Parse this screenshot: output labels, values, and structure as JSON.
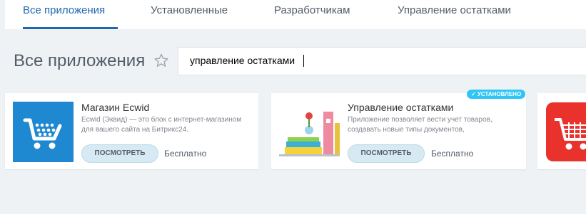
{
  "tabs": [
    {
      "label": "Все приложения",
      "active": true
    },
    {
      "label": "Установленные",
      "active": false
    },
    {
      "label": "Разработчикам",
      "active": false
    },
    {
      "label": "Управление остатками",
      "active": false
    }
  ],
  "page_title": "Все приложения",
  "search": {
    "value": "управление остатками"
  },
  "apps": [
    {
      "title": "Магазин Ecwid",
      "description": "Ecwid (Эквид) — это блок с интернет-магазином для вашего сайта на Битрикс24.",
      "button": "ПОСМОТРЕТЬ",
      "price": "Бесплатно",
      "icon": "shopping-cart-icon"
    },
    {
      "title": "Управление остатками",
      "description": "Приложение позволяет вести учет товаров, создавать новые типы документов,",
      "button": "ПОСМОТРЕТЬ",
      "price": "Бесплатно",
      "badge": "✓ УСТАНОВЛЕНО",
      "icon": "inventory-illustration-icon"
    },
    {
      "icon": "shopping-cart-icon"
    }
  ],
  "colors": {
    "accent": "#2067b0",
    "badge": "#2fc6f6",
    "ecwid_blue": "#1e88d0",
    "cart_red": "#e8322b"
  }
}
